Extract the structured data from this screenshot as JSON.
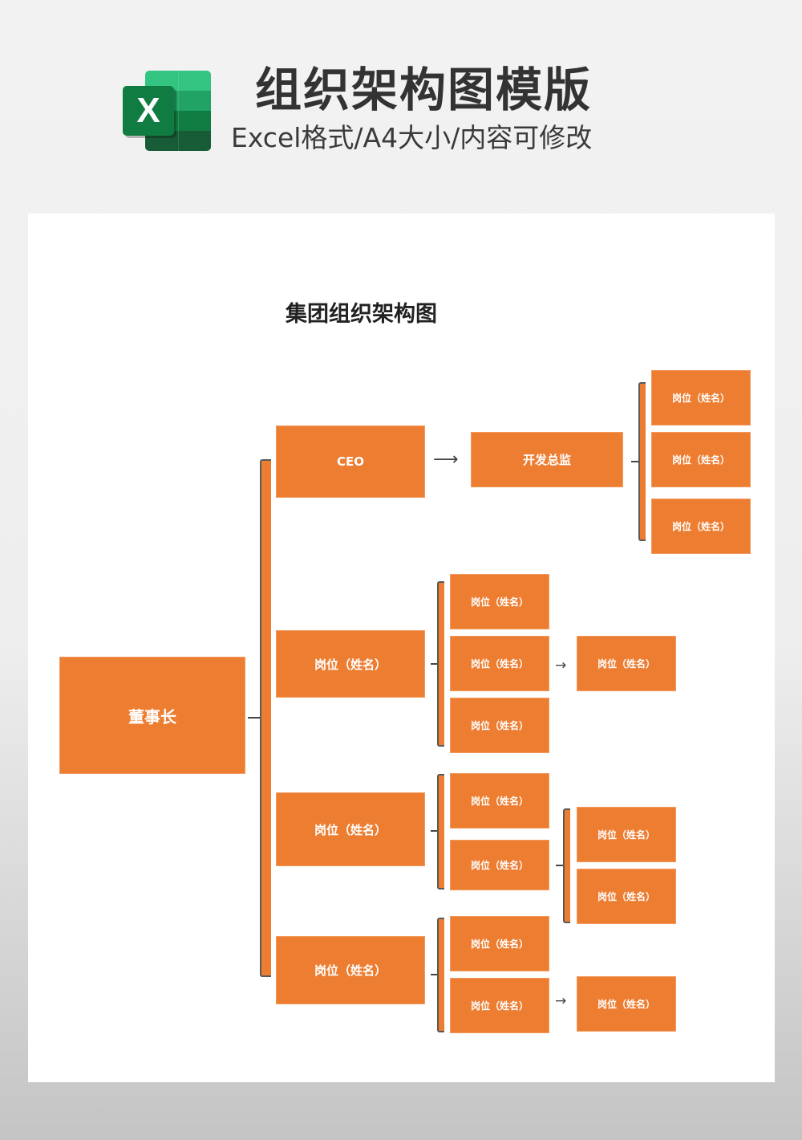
{
  "header": {
    "logo_letter": "X",
    "title": "组织架构图模版",
    "subtitle": "Excel格式/A4大小/内容可修改"
  },
  "document": {
    "title": "集团组织架构图"
  },
  "colors": {
    "node_fill": "#ed7d31",
    "node_text": "#ffffff",
    "connector": "#555555",
    "excel_green": "#107c41"
  },
  "org_chart": {
    "root": "董事长",
    "branches": [
      {
        "label": "CEO",
        "children": [
          {
            "label": "开发总监",
            "children": [
              "岗位（姓名）",
              "岗位（姓名）",
              "岗位（姓名）"
            ]
          }
        ]
      },
      {
        "label": "岗位（姓名）",
        "children": [
          {
            "label": "岗位（姓名）"
          },
          {
            "label": "岗位（姓名）",
            "children": [
              "岗位（姓名）"
            ]
          },
          {
            "label": "岗位（姓名）"
          }
        ]
      },
      {
        "label": "岗位（姓名）",
        "children": [
          {
            "label": "岗位（姓名）"
          },
          {
            "label": "岗位（姓名）",
            "children": [
              "岗位（姓名）",
              "岗位（姓名）"
            ]
          }
        ]
      },
      {
        "label": "岗位（姓名）",
        "children": [
          {
            "label": "岗位（姓名）"
          },
          {
            "label": "岗位（姓名）",
            "children": [
              "岗位（姓名）"
            ]
          }
        ]
      }
    ]
  }
}
